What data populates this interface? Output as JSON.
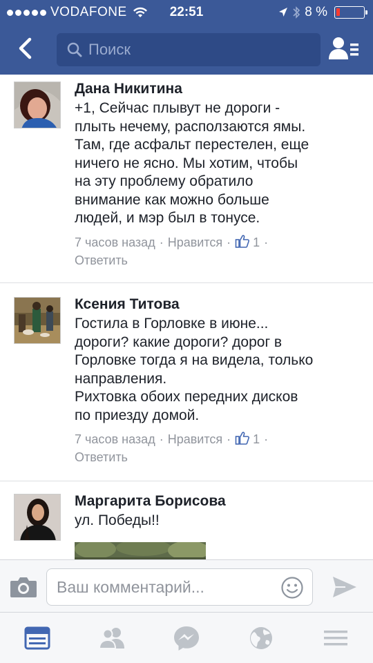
{
  "status_bar": {
    "carrier": "VODAFONE",
    "time": "22:51",
    "battery_text": "8 %"
  },
  "search": {
    "placeholder": "Поиск"
  },
  "comments": [
    {
      "author": "Дана Никитина",
      "text": "+1, Сейчас плывут не дороги -\nплыть нечему, расползаются ямы.\nТам, где асфальт перестелен, еще\nничего не ясно. Мы хотим, чтобы\nна эту проблему обратило\nвнимание как можно больше\nлюдей, и мэр был в тонусе.",
      "time": "7 часов назад",
      "like_label": "Нравится",
      "likes": "1",
      "reply_label": "Ответить"
    },
    {
      "author": "Ксения Титова",
      "text": "Гостила в Горловке  в июне...\nдороги? какие дороги? дорог в\nГорловке тогда я на видела, только\nнаправления.\nРихтовка обоих передних дисков\nпо приезду домой.",
      "time": "7 часов назад",
      "like_label": "Нравится",
      "likes": "1",
      "reply_label": "Ответить"
    },
    {
      "author": "Маргарита Борисова",
      "text": "ул. Победы!!"
    }
  ],
  "compose": {
    "placeholder": "Ваш комментарий..."
  },
  "icons": {
    "back": "chevron-left-icon",
    "search": "search-icon",
    "friends": "friend-requests-icon",
    "camera": "camera-icon",
    "sticker": "smiley-icon",
    "send": "send-icon",
    "tabs": [
      "news-feed-icon",
      "friends-icon",
      "messenger-icon",
      "notifications-globe-icon",
      "menu-icon"
    ]
  },
  "colors": {
    "brand": "#3b5998",
    "search_bg": "#2e4a86",
    "meta_gray": "#90949c",
    "active_tab": "#4267b2",
    "inactive_tab": "#bec3c9",
    "low_battery": "#ff3b30"
  }
}
